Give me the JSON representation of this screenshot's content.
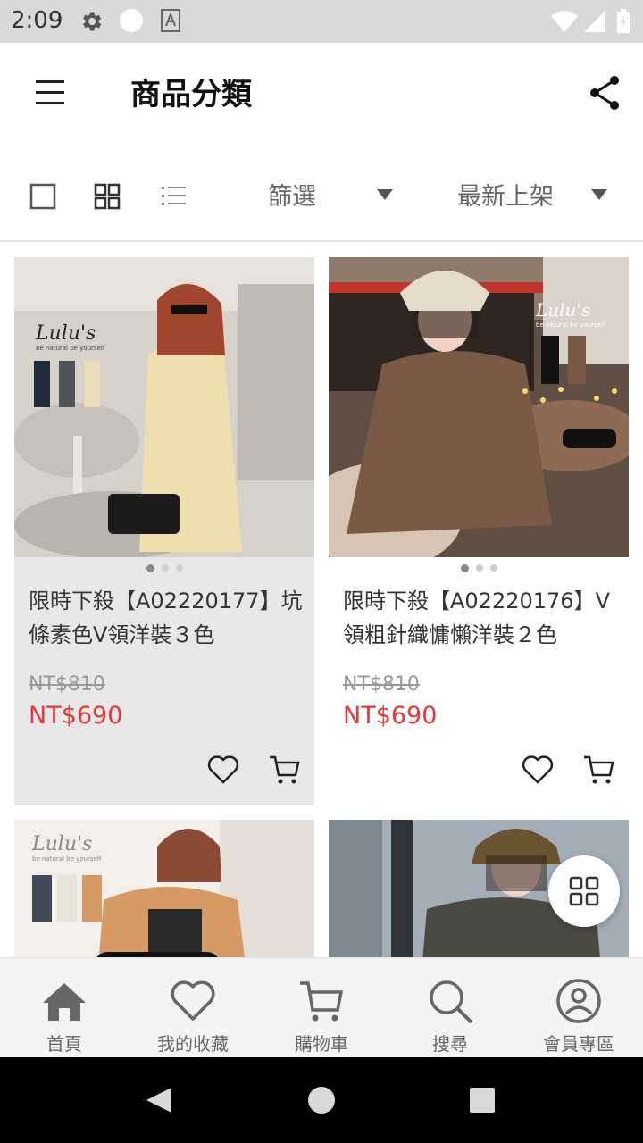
{
  "status_bar": {
    "time": "2:09"
  },
  "app_bar": {
    "title": "商品分類"
  },
  "toolbar": {
    "filter_label": "篩選",
    "sort_label": "最新上架"
  },
  "products": [
    {
      "name": "限時下殺【A02220177】坑條素色V領洋裝３色",
      "original_price": "NT$810",
      "sale_price": "NT$690",
      "image_text": "Lulu's be natural be yourself",
      "palette": {
        "bg": "#d8d4cc",
        "dress": "#efe0b0",
        "table": "#c9c6c0"
      }
    },
    {
      "name": "限時下殺【A02220176】V領粗針織慵懶洋裝２色",
      "original_price": "NT$810",
      "sale_price": "NT$690",
      "image_text": "Lulu's be natural be yourself",
      "palette": {
        "bg": "#6e5a4a",
        "dress": "#7a5a45",
        "table": "#3a2f29"
      }
    },
    {
      "name": "",
      "image_text": "Lulu's be natural be yourself",
      "palette": {
        "bg": "#f1ede8",
        "dress": "#d4915a"
      }
    },
    {
      "name": "",
      "palette": {
        "bg": "#9aa6b2",
        "dress": "#4a4a42"
      }
    }
  ],
  "bottom_nav": [
    {
      "label": "首頁",
      "icon": "home-icon"
    },
    {
      "label": "我的收藏",
      "icon": "heart-icon"
    },
    {
      "label": "購物車",
      "icon": "cart-icon"
    },
    {
      "label": "搜尋",
      "icon": "search-icon"
    },
    {
      "label": "會員專區",
      "icon": "person-icon"
    }
  ],
  "colors": {
    "sale": "#e53935",
    "nav_active": "#666666"
  }
}
